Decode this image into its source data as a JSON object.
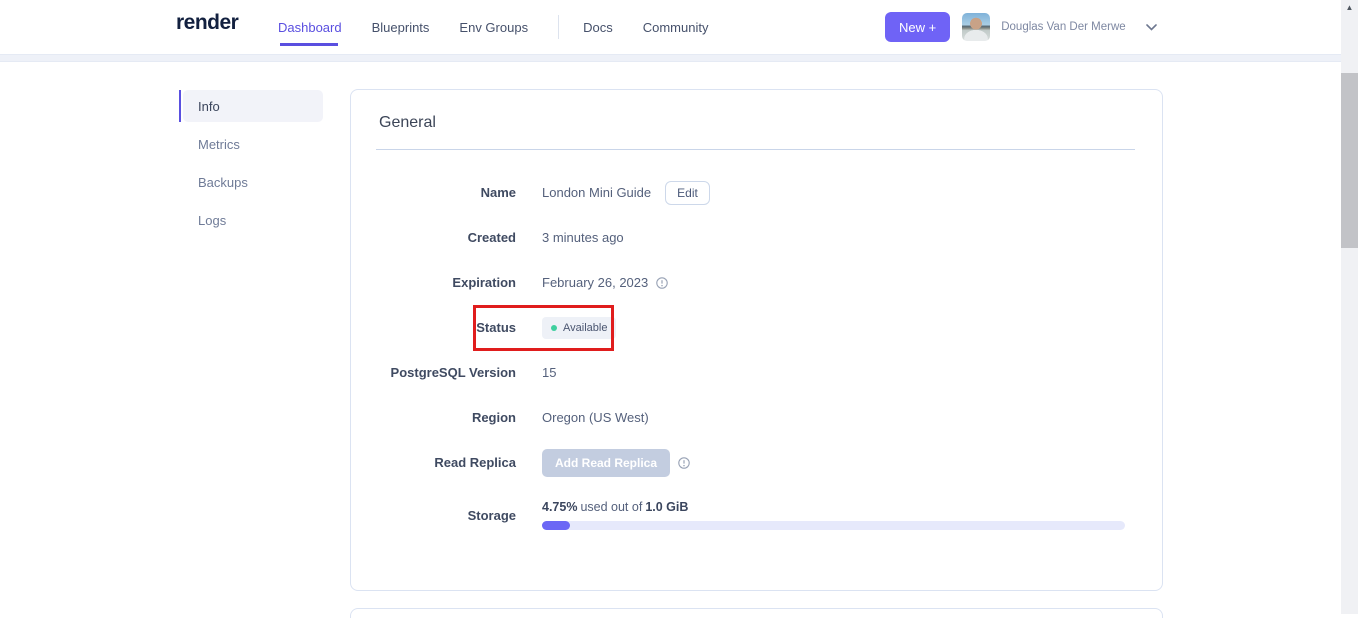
{
  "header": {
    "logo": "render",
    "nav": [
      {
        "label": "Dashboard",
        "active": true
      },
      {
        "label": "Blueprints",
        "active": false
      },
      {
        "label": "Env Groups",
        "active": false
      },
      {
        "label": "Docs",
        "active": false
      },
      {
        "label": "Community",
        "active": false
      }
    ],
    "new_button_label": "New +",
    "user_name": "Douglas Van Der Merwe"
  },
  "sidebar": {
    "items": [
      {
        "label": "Info",
        "active": true
      },
      {
        "label": "Metrics",
        "active": false
      },
      {
        "label": "Backups",
        "active": false
      },
      {
        "label": "Logs",
        "active": false
      }
    ]
  },
  "general_card": {
    "title": "General",
    "fields": {
      "name": {
        "label": "Name",
        "value": "London Mini Guide",
        "action_label": "Edit"
      },
      "created": {
        "label": "Created",
        "value": "3 minutes ago"
      },
      "expiration": {
        "label": "Expiration",
        "value": "February 26, 2023",
        "has_info_icon": true
      },
      "status": {
        "label": "Status",
        "badge": "Available",
        "highlighted": true
      },
      "postgres_version": {
        "label": "PostgreSQL Version",
        "value": "15"
      },
      "region": {
        "label": "Region",
        "value": "Oregon (US West)"
      },
      "read_replica": {
        "label": "Read Replica",
        "button_label": "Add Read Replica",
        "button_disabled": true,
        "has_info_icon": true
      },
      "storage": {
        "label": "Storage",
        "used_percent": "4.75%",
        "connector_text": "used out of",
        "total": "1.0 GiB",
        "fill_percent": 4.75
      }
    }
  },
  "annotation": {
    "type": "red-highlight-box",
    "around": "status-row",
    "color": "#e01d1d"
  },
  "icons": {
    "chevron_down": "chevron-down",
    "info": "info-circle",
    "scroll_up_arrow": "▲",
    "status_dot": "green-dot"
  },
  "colors": {
    "accent_purple": "#5a4fe0",
    "new_button_purple": "#6f63f6",
    "status_dot_green": "#3ecf9e",
    "progress_fill": "#6c67f5",
    "progress_track": "#e6e9fb",
    "highlight_red": "#e01d1d"
  }
}
